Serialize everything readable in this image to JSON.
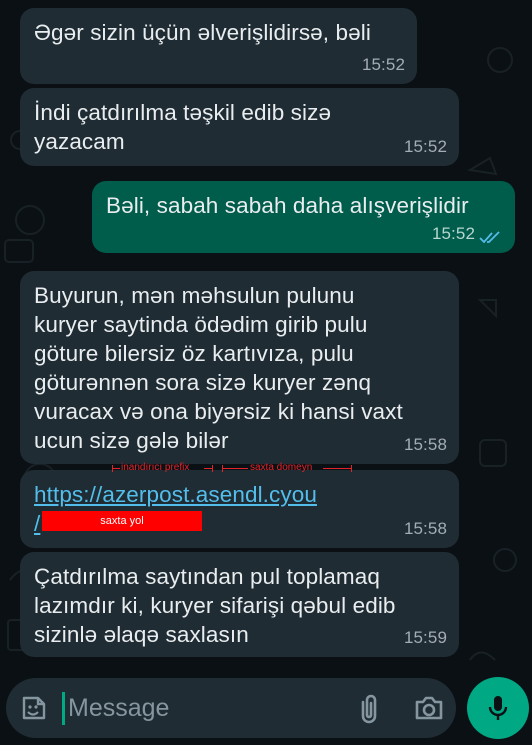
{
  "messages": [
    {
      "text": "Əgər sizin üçün əlverişlidirsə, bəli",
      "time": "15:52",
      "direction": "incoming"
    },
    {
      "text": "İndi çatdırılma təşkil edib sizə\nyazacam",
      "time": "15:52",
      "direction": "incoming"
    },
    {
      "text": "Bəli, sabah sabah daha alışverişlidir",
      "time": "15:52",
      "direction": "outgoing",
      "status": "read"
    },
    {
      "text": "Buyurun, mən məhsulun pulunu\nkuryer saytinda ödədim girib pulu\ngöture bilersiz öz kartıvıza, pulu\ngöturənnən sora sizə kuryer zənq\nvuracax və ona biyərsiz ki hansi vaxt\nucun sizə gələ bilər",
      "time": "15:58",
      "direction": "incoming"
    },
    {
      "link": "https://azerpost.asendl.cyou",
      "link_slash": "/",
      "time": "15:58",
      "direction": "incoming"
    },
    {
      "text": "Çatdırılma saytından pul toplamaq\nlazımdır ki, kuryer sifarişi qəbul edib\nsizinlə əlaqə saxlasın",
      "time": "15:59",
      "direction": "incoming"
    }
  ],
  "annotations": {
    "prefix_label": "inandırıcı prefix",
    "domain_label": "saxta domeyn",
    "redacted_label": "saxta yol"
  },
  "input": {
    "placeholder": "Message"
  },
  "icons": {
    "emoji": "sticker-icon",
    "attach": "paperclip-icon",
    "camera": "camera-icon",
    "send": "microphone-icon",
    "read_status": "double-check-icon"
  },
  "colors": {
    "background": "#0b1014",
    "incoming_bubble": "#1f2c33",
    "outgoing_bubble": "#005c4b",
    "link": "#53bdeb",
    "accent": "#00a884",
    "annotation": "#e0242a",
    "redaction": "#ff0000",
    "read_ticks": "#53bdeb"
  }
}
